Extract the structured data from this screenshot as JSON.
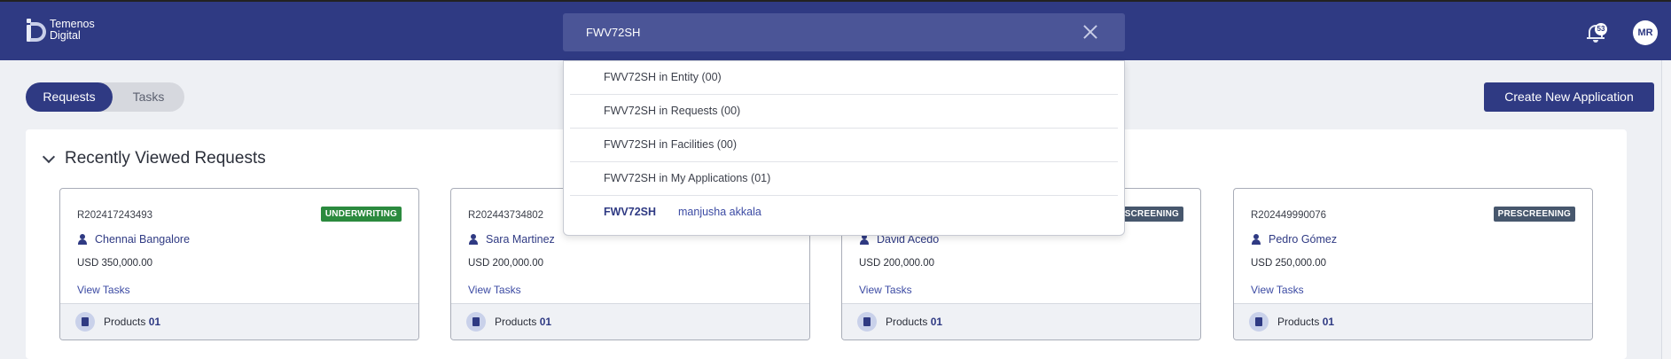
{
  "header": {
    "logo_line1": "Temenos",
    "logo_line2": "Digital",
    "search_value": "FWV72SH",
    "notification_count": "53",
    "avatar_initials": "MR"
  },
  "toggle": {
    "requests_label": "Requests",
    "tasks_label": "Tasks",
    "active": "Requests"
  },
  "create_button_label": "Create New Application",
  "panel": {
    "title": "Recently Viewed Requests"
  },
  "cards": [
    {
      "id": "R202417243493",
      "status": "UNDERWRITING",
      "name": "Chennai Bangalore",
      "amount": "USD 350,000.00",
      "link": "View Tasks",
      "products_label": "Products",
      "products_count": "01"
    },
    {
      "id": "R202443734802",
      "status": "",
      "name": "Sara Martinez",
      "amount": "USD 200,000.00",
      "link": "View Tasks",
      "products_label": "Products",
      "products_count": "01"
    },
    {
      "id": "",
      "status": "ESCREENING",
      "name": "David Acedo",
      "amount": "USD 200,000.00",
      "link": "View Tasks",
      "products_label": "Products",
      "products_count": "01"
    },
    {
      "id": "R202449990076",
      "status": "PRESCREENING",
      "name": "Pedro Gómez",
      "amount": "USD 250,000.00",
      "link": "View Tasks",
      "products_label": "Products",
      "products_count": "01"
    }
  ],
  "dropdown": {
    "items": [
      "FWV72SH in Entity (00)",
      "FWV72SH in Requests (00)",
      "FWV72SH in Facilities (00)",
      "FWV72SH in My Applications (01)"
    ],
    "result": {
      "code": "FWV72SH",
      "user": "manjusha akkala"
    }
  },
  "colors": {
    "brand": "#2f3a83",
    "underwriting": "#2b8a3e",
    "prescreening": "#47576d"
  }
}
